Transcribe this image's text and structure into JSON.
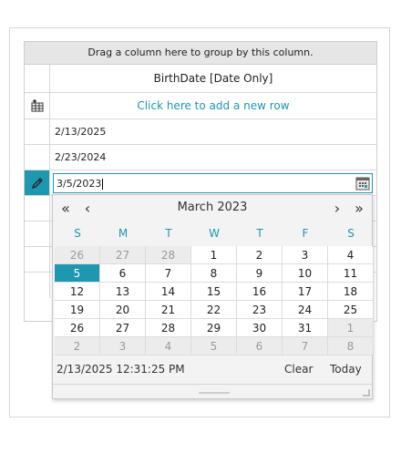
{
  "grid": {
    "group_panel_text": "Drag a column here to group by this column.",
    "column_header": "BirthDate [Date Only]",
    "new_row_text": "Click here to add a new row",
    "rows": [
      "2/13/2025",
      "2/23/2024"
    ],
    "editor_value": "3/5/2023"
  },
  "calendar": {
    "month_title": "March 2023",
    "nav": {
      "prev_year": "«",
      "prev_month": "‹",
      "next_month": "›",
      "next_year": "»"
    },
    "day_names": [
      "S",
      "M",
      "T",
      "W",
      "T",
      "F",
      "S"
    ],
    "days": [
      {
        "n": "26",
        "o": true
      },
      {
        "n": "27",
        "o": true
      },
      {
        "n": "28",
        "o": true
      },
      {
        "n": "1"
      },
      {
        "n": "2"
      },
      {
        "n": "3"
      },
      {
        "n": "4"
      },
      {
        "n": "5",
        "s": true
      },
      {
        "n": "6"
      },
      {
        "n": "7"
      },
      {
        "n": "8"
      },
      {
        "n": "9"
      },
      {
        "n": "10"
      },
      {
        "n": "11"
      },
      {
        "n": "12"
      },
      {
        "n": "13"
      },
      {
        "n": "14"
      },
      {
        "n": "15"
      },
      {
        "n": "16"
      },
      {
        "n": "17"
      },
      {
        "n": "18"
      },
      {
        "n": "19"
      },
      {
        "n": "20"
      },
      {
        "n": "21"
      },
      {
        "n": "22"
      },
      {
        "n": "23"
      },
      {
        "n": "24"
      },
      {
        "n": "25"
      },
      {
        "n": "26"
      },
      {
        "n": "27"
      },
      {
        "n": "28"
      },
      {
        "n": "29"
      },
      {
        "n": "30"
      },
      {
        "n": "31"
      },
      {
        "n": "1",
        "o": true
      },
      {
        "n": "2",
        "o": true
      },
      {
        "n": "3",
        "o": true
      },
      {
        "n": "4",
        "o": true
      },
      {
        "n": "5",
        "o": true
      },
      {
        "n": "6",
        "o": true
      },
      {
        "n": "7",
        "o": true
      },
      {
        "n": "8",
        "o": true
      }
    ],
    "now_text": "2/13/2025 12:31:25 PM",
    "clear_label": "Clear",
    "today_label": "Today"
  },
  "colors": {
    "accent": "#1e97b0",
    "header_bg": "#e6e6e6"
  },
  "icons": {
    "new_row": "add-row-icon",
    "edit": "pencil-icon",
    "calendar": "calendar-icon"
  }
}
